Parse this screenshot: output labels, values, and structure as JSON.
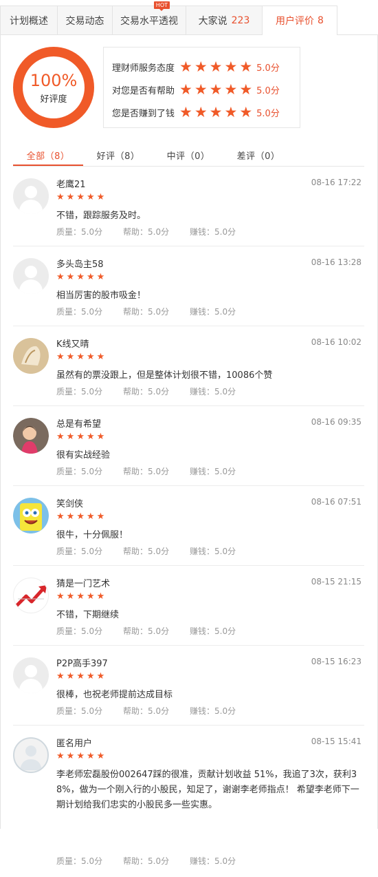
{
  "tabs": [
    {
      "label": "计划概述",
      "count": "",
      "hot": ""
    },
    {
      "label": "交易动态",
      "count": "",
      "hot": ""
    },
    {
      "label": "交易水平透视",
      "count": "",
      "hot": "HOT"
    },
    {
      "label": "大家说",
      "count": "223",
      "hot": ""
    },
    {
      "label": "用户评价",
      "count": "8",
      "hot": ""
    }
  ],
  "summary": {
    "percent": "100%",
    "percent_label": "好评度",
    "scores": [
      {
        "name": "理财师服务态度",
        "value": "5.0分"
      },
      {
        "name": "对您是否有帮助",
        "value": "5.0分"
      },
      {
        "name": "您是否赚到了钱",
        "value": "5.0分"
      }
    ]
  },
  "filters": [
    {
      "label": "全部（8）"
    },
    {
      "label": "好评（8）"
    },
    {
      "label": "中评（0）"
    },
    {
      "label": "差评（0）"
    }
  ],
  "metric_labels": {
    "quality": "质量：5.0分",
    "help": "帮助：5.0分",
    "earn": "赚钱：5.0分"
  },
  "reviews": [
    {
      "user": "老鹰21",
      "time": "08-16 17:22",
      "text": "不错，跟踪服务及时。",
      "avatar": "default-avatar"
    },
    {
      "user": "多头岛主58",
      "time": "08-16 13:28",
      "text": "相当厉害的股市吸金！",
      "avatar": "default-avatar"
    },
    {
      "user": "K线又晴",
      "time": "08-16 10:02",
      "text": "虽然有的票没跟上，但是整体计划很不错，10086个赞",
      "avatar": "shell-avatar"
    },
    {
      "user": "总是有希望",
      "time": "08-16 09:35",
      "text": "很有实战经验",
      "avatar": "child-avatar"
    },
    {
      "user": "笑剑侠",
      "time": "08-16 07:51",
      "text": "很牛，十分佩服！",
      "avatar": "sponge-avatar"
    },
    {
      "user": "猜是一门艺术",
      "time": "08-15 21:15",
      "text": "不错，下期继续",
      "avatar": "chart-arrow-avatar"
    },
    {
      "user": "P2P高手397",
      "time": "08-15 16:23",
      "text": "很棒，也祝老师提前达成目标",
      "avatar": "default-avatar"
    },
    {
      "user": "匿名用户",
      "time": "08-15 15:41",
      "text": "李老师宏磊股份002647踩的很准，贡献计划收益 51%，我追了3次，获利38%，做为一个刚入行的小股民，知足了，谢谢李老师指点！ 希望李老师下一期计划给我们忠实的小股民多一些实惠。",
      "avatar": "anonymous-avatar"
    }
  ],
  "colors": {
    "accent": "#f05a28"
  }
}
